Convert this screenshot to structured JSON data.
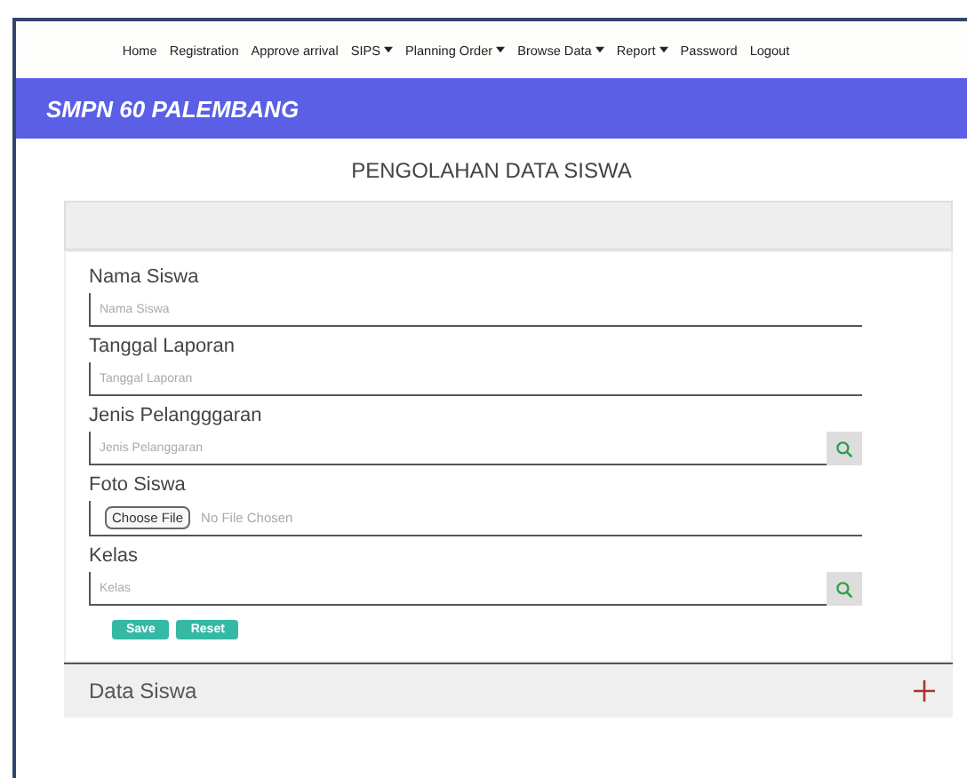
{
  "nav": [
    {
      "label": "Home",
      "dropdown": false
    },
    {
      "label": "Registration",
      "dropdown": false
    },
    {
      "label": "Approve arrival",
      "dropdown": false
    },
    {
      "label": "SIPS",
      "dropdown": true
    },
    {
      "label": "Planning Order",
      "dropdown": true
    },
    {
      "label": "Browse Data",
      "dropdown": true
    },
    {
      "label": "Report",
      "dropdown": true
    },
    {
      "label": "Password",
      "dropdown": false
    },
    {
      "label": "Logout",
      "dropdown": false
    }
  ],
  "brand": "SMPN 60 PALEMBANG",
  "page_title": "PENGOLAHAN DATA SISWA",
  "fields": [
    {
      "kind": "text",
      "label": "Nama Siswa",
      "placeholder": "Nama Siswa"
    },
    {
      "kind": "text",
      "label": "Tanggal Laporan",
      "placeholder": "Tanggal Laporan"
    },
    {
      "kind": "lookup",
      "label": "Jenis Pelangggaran",
      "placeholder": "Jenis Pelanggaran"
    },
    {
      "kind": "file",
      "label": "Foto Siswa",
      "button": "Choose File",
      "status": "No File Chosen"
    },
    {
      "kind": "lookup",
      "label": "Kelas",
      "placeholder": "Kelas"
    }
  ],
  "buttons": [
    "Save",
    "Reset"
  ],
  "panel": {
    "title": "Data Siswa",
    "expanded": false
  }
}
